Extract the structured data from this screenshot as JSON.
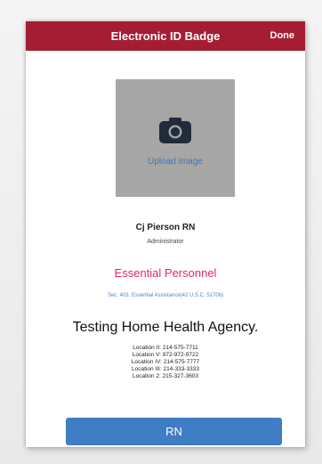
{
  "header": {
    "title": "Electronic ID Badge",
    "done_label": "Done"
  },
  "photo": {
    "icon": "camera-icon",
    "upload_label": "Upload image"
  },
  "person": {
    "name": "Cj Pierson RN",
    "role": "Administrator"
  },
  "badge": {
    "essential_label": "Essential Personnel",
    "legal_text": "Sec. 403. Essential Assistance(42 U.S.C. 5170b)"
  },
  "agency": {
    "name": "Testing Home Health Agency.",
    "locations": [
      "Location II: 214-575-7711",
      "Location V: 972-972-9722",
      "Location IV: 214-575-7777",
      "Location III: 214-333-3333",
      "Location 2: 215-327-3603"
    ]
  },
  "footer": {
    "button_label": "RN"
  },
  "colors": {
    "header_bg": "#a51d32",
    "essential": "#e3276a",
    "button_bg": "#3f7dc4",
    "photo_bg": "#a6a6a6"
  }
}
